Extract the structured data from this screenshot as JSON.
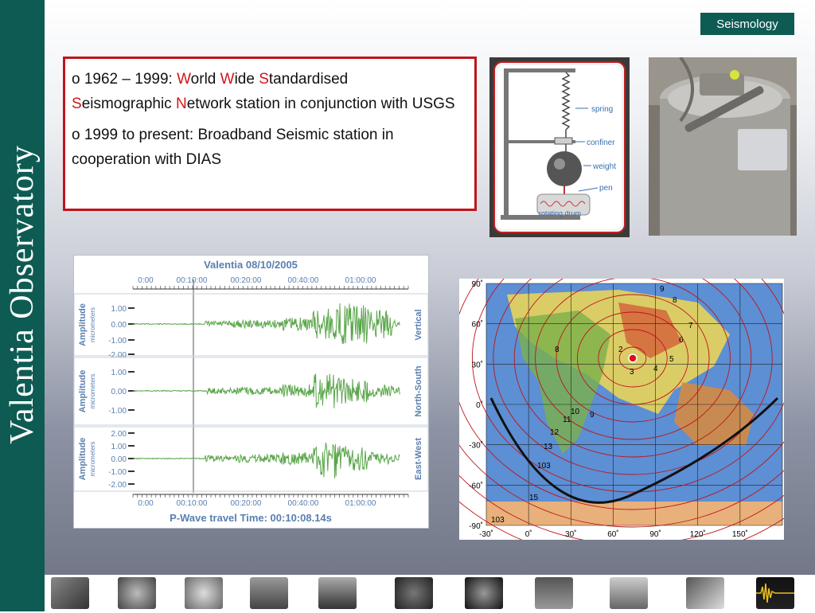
{
  "sidebar": {
    "title": "Valentia  Observatory"
  },
  "section_tag": "Seismology",
  "textbox": {
    "p1": {
      "bullet": "o",
      "years": " 1962 – 1999: ",
      "w1": "W",
      "w1_rest": "orld ",
      "w2": "W",
      "w2_rest": "ide ",
      "s1": "S",
      "s1_rest": "tandardised",
      "s2": "S",
      "s2_rest": "eismographic ",
      "n1": "N",
      "n1_rest": "etwork station in conjunction with USGS"
    },
    "p2": {
      "bullet": "o",
      "text": " 1999 to present:  Broadband Seismic station in cooperation with DIAS"
    }
  },
  "diagram": {
    "labels": [
      "spring",
      "confiner",
      "weight",
      "pen",
      "rotating drum"
    ]
  },
  "seismogram": {
    "title": "Valentia 08/10/2005",
    "time_ticks": [
      "0:00",
      "00:10:00",
      "00:20:00",
      "00:40:00",
      "01:00:00"
    ],
    "footer": "P-Wave travel Time: 00:10:08.14s",
    "channels": [
      {
        "name": "Vertical",
        "ylabel": "Amplitude",
        "yunit": "micrometers",
        "ticks": [
          "1.00",
          "0.00",
          "-1.00",
          "-2.00"
        ]
      },
      {
        "name": "North-South",
        "ylabel": "Amplitude",
        "yunit": "micrometers",
        "ticks": [
          "1.00",
          "0.00",
          "-1.00"
        ]
      },
      {
        "name": "East-West",
        "ylabel": "Amplitude",
        "yunit": "micrometers",
        "ticks": [
          "2.00",
          "1.00",
          "0.00",
          "-1.00",
          "-2.00"
        ]
      }
    ],
    "trace_color": "#5aa64a"
  },
  "map": {
    "lat_labels": [
      "90˚",
      "60˚",
      "30˚",
      "0˚",
      "-30˚",
      "-60˚",
      "-90˚"
    ],
    "lon_labels": [
      "-30˚",
      "0˚",
      "30˚",
      "60˚",
      "90˚",
      "120˚",
      "150˚"
    ],
    "contour_labels": [
      "9",
      "8",
      "7",
      "6",
      "5",
      "4",
      "3",
      "2",
      "8",
      "10",
      "9",
      "11",
      "12",
      "13",
      "103",
      "15",
      "103"
    ]
  },
  "thumbnails": [
    "building-thumbnail",
    "dome-thumbnail",
    "sphere-thumbnail",
    "instrument-thumbnail",
    "tree-thumbnail",
    "sun-thumbnail",
    "gauge-thumbnail",
    "aurora-thumbnail",
    "station-thumbnail",
    "magnetometer-thumbnail",
    "seismogram-thumbnail"
  ]
}
